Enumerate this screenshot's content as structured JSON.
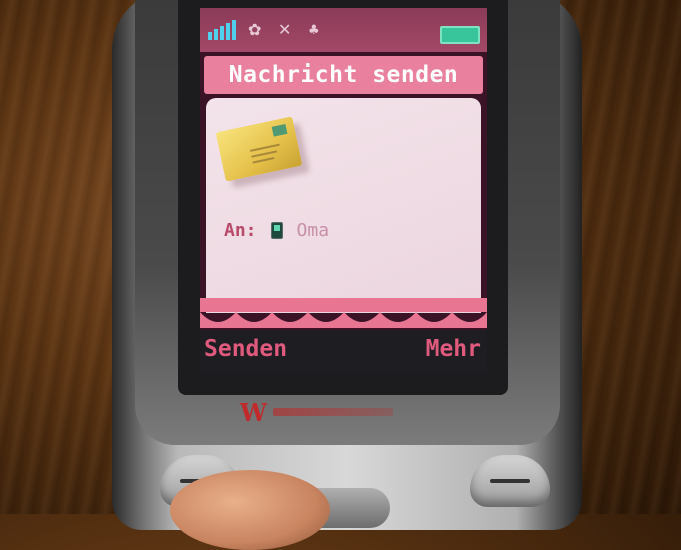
{
  "screen": {
    "title": "Nachricht senden",
    "recipient_label": "An:",
    "recipient_name": "Oma",
    "softkey_left": "Senden",
    "softkey_right": "Mehr"
  },
  "icons": [
    "signal-icon",
    "flower-icon",
    "mute-icon",
    "profile-icon",
    "battery-icon",
    "envelope-icon",
    "mobile-phone-icon"
  ],
  "colors": {
    "title_bar": "#e8809e",
    "softkey_text": "#e05a7e",
    "status_bar": "#8a3b57",
    "battery": "#39c59b"
  }
}
